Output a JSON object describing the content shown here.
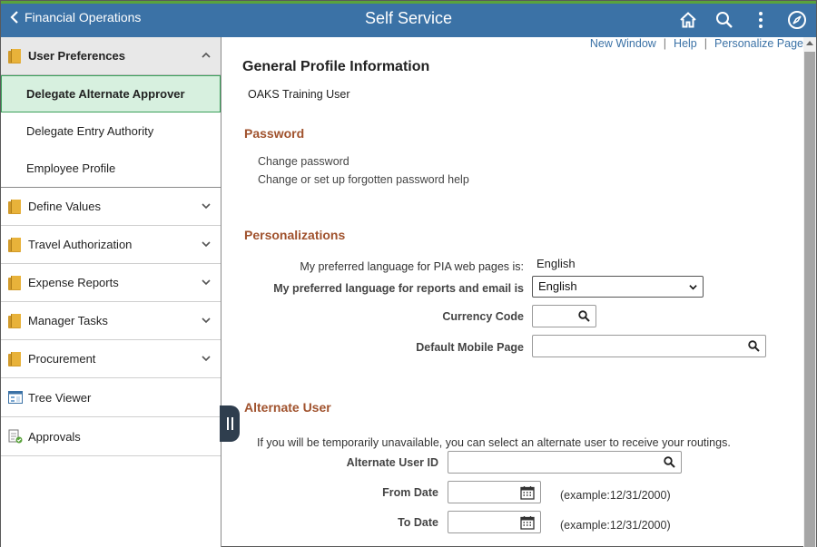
{
  "header": {
    "back_label": "Financial Operations",
    "title": "Self Service",
    "icons": [
      "home-icon",
      "search-icon",
      "more-options-icon",
      "navbar-icon"
    ]
  },
  "sidebar": {
    "groups": [
      {
        "label": "User Preferences",
        "expanded": true,
        "items": [
          {
            "label": "Delegate Alternate Approver",
            "active": true
          },
          {
            "label": "Delegate Entry Authority",
            "active": false
          },
          {
            "label": "Employee Profile",
            "active": false
          }
        ]
      },
      {
        "label": "Define Values",
        "expanded": false
      },
      {
        "label": "Travel Authorization",
        "expanded": false
      },
      {
        "label": "Expense Reports",
        "expanded": false
      },
      {
        "label": "Manager Tasks",
        "expanded": false
      },
      {
        "label": "Procurement",
        "expanded": false
      }
    ],
    "tools": [
      {
        "label": "Tree Viewer",
        "icon": "tree-viewer-icon"
      },
      {
        "label": "Approvals",
        "icon": "approvals-icon"
      }
    ]
  },
  "links": {
    "new_window": "New Window",
    "help": "Help",
    "personalize": "Personalize Page"
  },
  "page": {
    "title": "General Profile Information",
    "user_name": "OAKS Training User",
    "password": {
      "heading": "Password",
      "change": "Change password",
      "forgotten": "Change or set up forgotten password help"
    },
    "personalizations": {
      "heading": "Personalizations",
      "pia_language_label": "My preferred language for PIA web pages is:",
      "pia_language_value": "English",
      "report_language_label": "My preferred language for reports and email is",
      "report_language_value": "English",
      "currency_label": "Currency Code",
      "currency_value": "",
      "mobile_label": "Default Mobile Page",
      "mobile_value": ""
    },
    "alternate": {
      "heading": "Alternate User",
      "description": "If you will be temporarily unavailable, you can select an alternate user to receive your routings.",
      "user_id_label": "Alternate User ID",
      "user_id_value": "",
      "from_label": "From Date",
      "from_value": "",
      "to_label": "To Date",
      "to_value": "",
      "example": "(example:12/31/2000)"
    }
  },
  "colors": {
    "header": "#3b72a6",
    "accent_green": "#5aa33c",
    "section_heading": "#a0522d",
    "active_item_bg": "#d7f0df"
  }
}
